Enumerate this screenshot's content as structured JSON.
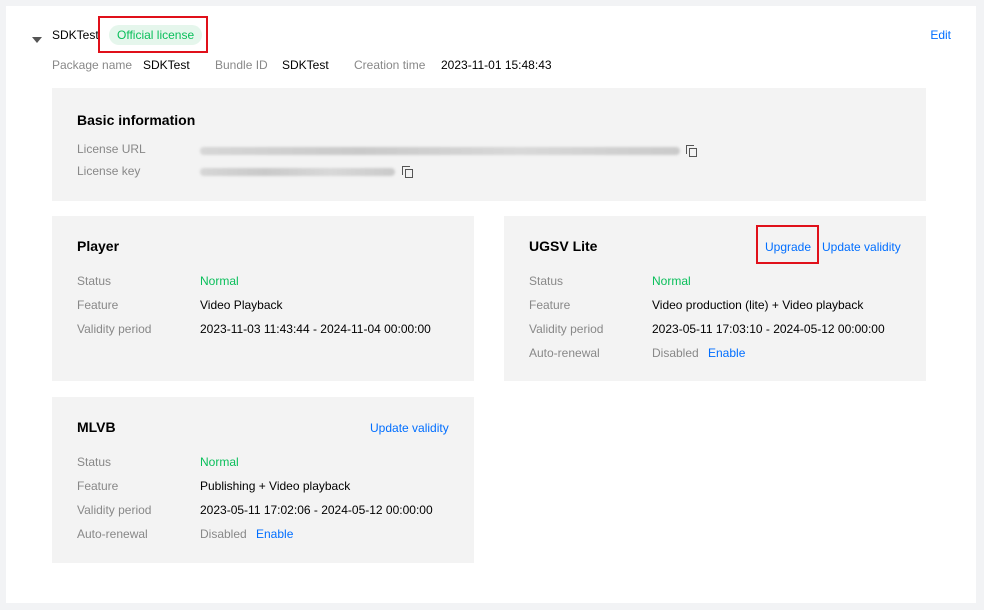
{
  "app": {
    "name": "SDKTest",
    "badge": "Official license",
    "edit": "Edit"
  },
  "meta": {
    "package_label": "Package name",
    "package_value": "SDKTest",
    "bundle_label": "Bundle ID",
    "bundle_value": "SDKTest",
    "creation_label": "Creation time",
    "creation_value": "2023-11-01 15:48:43"
  },
  "basic": {
    "title": "Basic information",
    "license_url_label": "License URL",
    "license_key_label": "License key"
  },
  "player": {
    "title": "Player",
    "status_label": "Status",
    "status_value": "Normal",
    "feature_label": "Feature",
    "feature_value": "Video Playback",
    "validity_label": "Validity period",
    "validity_value": "2023-11-03 11:43:44 - 2024-11-04 00:00:00"
  },
  "ugsv": {
    "title": "UGSV Lite",
    "upgrade": "Upgrade",
    "update_validity": "Update validity",
    "status_label": "Status",
    "status_value": "Normal",
    "feature_label": "Feature",
    "feature_value": "Video production (lite) + Video playback",
    "validity_label": "Validity period",
    "validity_value": "2023-05-11 17:03:10 - 2024-05-12 00:00:00",
    "renewal_label": "Auto-renewal",
    "renewal_value": "Disabled",
    "enable": "Enable"
  },
  "mlvb": {
    "title": "MLVB",
    "update_validity": "Update validity",
    "status_label": "Status",
    "status_value": "Normal",
    "feature_label": "Feature",
    "feature_value": "Publishing + Video playback",
    "validity_label": "Validity period",
    "validity_value": "2023-05-11 17:02:06 - 2024-05-12 00:00:00",
    "renewal_label": "Auto-renewal",
    "renewal_value": "Disabled",
    "enable": "Enable"
  },
  "colors": {
    "accent": "#006eff",
    "success": "#0abf5b",
    "highlight": "#e0101a"
  }
}
